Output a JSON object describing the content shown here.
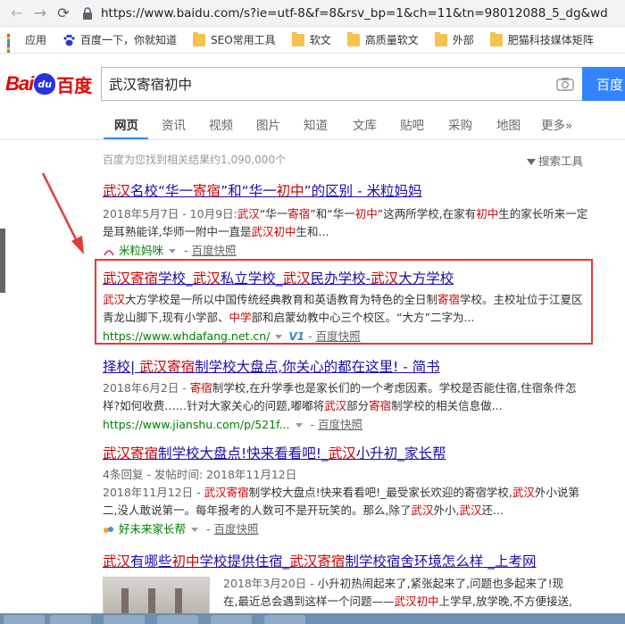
{
  "browser": {
    "url": "https://www.baidu.com/s?ie=utf-8&f=8&rsv_bp=1&ch=11&tn=98012088_5_dg&wd"
  },
  "bookmarks": [
    {
      "label": "应用",
      "icon": "apps-icon"
    },
    {
      "label": "百度一下，你就知道",
      "icon": "baidu-paw-icon"
    },
    {
      "label": "SEO常用工具",
      "icon": "folder-icon"
    },
    {
      "label": "软文",
      "icon": "folder-icon"
    },
    {
      "label": "高质量软文",
      "icon": "folder-icon"
    },
    {
      "label": "外部",
      "icon": "folder-icon"
    },
    {
      "label": "肥猫科技媒体矩阵",
      "icon": "folder-icon"
    }
  ],
  "header": {
    "logo_bai": "Bai",
    "logo_paw": "du",
    "logo_du": "百度",
    "search_value": "武汉寄宿初中",
    "search_button": "百度"
  },
  "tabs": [
    {
      "label": "网页",
      "active": true
    },
    {
      "label": "资讯"
    },
    {
      "label": "视频"
    },
    {
      "label": "图片"
    },
    {
      "label": "知道"
    },
    {
      "label": "文库"
    },
    {
      "label": "贴吧"
    },
    {
      "label": "采购"
    },
    {
      "label": "地图"
    },
    {
      "label": "更多»"
    }
  ],
  "result_count": "百度为您找到相关结果约1,090,000个",
  "search_tools": "搜索工具",
  "results": [
    {
      "title_html": "<em>武汉</em>名校“华一<em>寄宿</em>”和“华一<em>初中</em>”的区别 - 米粒妈妈",
      "abstract_html": "<span class='date'>2018年5月7日 - 10月9日:</span><em>武汉</em>“华一<em>寄宿</em>”和“华一<em>初中</em>”这两所学校,在家有<em>初中</em>生的家长听来一定是耳熟能详,华师一附中一直是<em>武汉初中</em>生和...",
      "site": "米粒妈咪",
      "kuaizhao": "百度快照",
      "site_color": "#008000"
    },
    {
      "title_html": "<em>武汉寄宿</em>学校_<em>武汉</em>私立学校_<em>武汉</em>民办学校-<em>武汉</em>大方学校",
      "abstract_html": "<em>武汉</em>大方学校是一所以中国传统经典教育和英语教育为特色的全日制<em>寄宿</em>学校。主校址位于江夏区青龙山脚下,现有小学部、<em>中学</em>部和启蒙幼教中心三个校区。“大方”二字为...",
      "site": "https://www.whdafang.net.cn/",
      "badge": "V1",
      "kuaizhao": "百度快照"
    },
    {
      "title_html": "择校| <em>武汉寄宿</em>制学校大盘点,你关心的都在这里! - 简书",
      "abstract_html": "<span class='date'>2018年6月2日 - </span><em>寄宿</em>制学校,在升学季也是家长们的一个考虑因素。学校是否能住宿,住宿条件怎样?如何收费……针对大家关心的问题,嘟嘟将<em>武汉</em>部分<em>寄宿</em>制学校的相关信息做...",
      "site": "https://www.jianshu.com/p/521f...",
      "kuaizhao": "百度快照"
    },
    {
      "title_html": "<em>武汉寄宿</em>制学校大盘点!快来看看吧!_<em>武汉</em>小升初_家长帮",
      "abstract_html": "<span class='date'>4条回复 - 发帖时间: 2018年11月12日</span><br><span class='date'>2018年11月12日 - </span><em>武汉寄宿</em>制学校大盘点!快来看看吧!_最受家长欢迎的寄宿学校,<em>武汉</em>外小说第二,没人敢说第一。每年报考的人数可不是开玩笑的。那么,除了<em>武汉</em>外小,<em>武汉</em>还...",
      "site": "好未来家长帮",
      "kuaizhao": "百度快照"
    },
    {
      "title_html": "<em>武汉</em>有哪些<em>初中</em>学校提供住宿_<em>武汉寄宿</em>制学校宿舍环境怎么样 _上考网",
      "abstract_html": "<span class='date'>2018年3月20日 - </span>小升初热闹起来了,紧张起来了,问题也多起来了!现在,最近总会遇到这样一个问题——<em>武汉初中</em>上学早,放学晚,不方便接送,<em>武</em>"
    }
  ]
}
